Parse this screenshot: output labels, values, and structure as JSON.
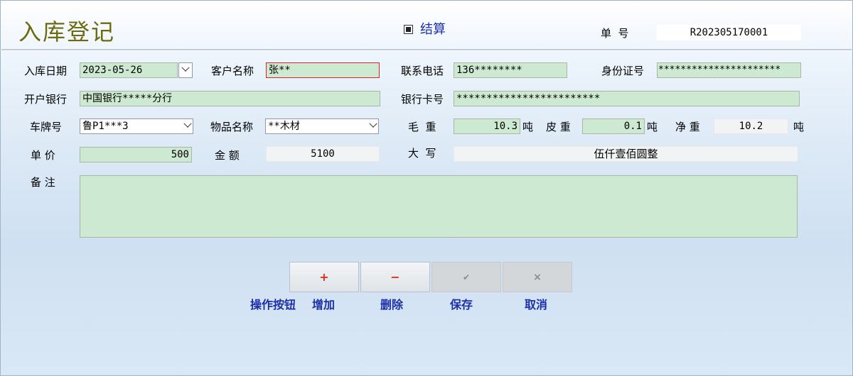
{
  "header": {
    "title": "入库登记",
    "settle_label": "结算",
    "settle_checked": true,
    "doc_no_label": "单  号",
    "doc_no": "R202305170001"
  },
  "form": {
    "date_label": "入库日期",
    "date": "2023-05-26",
    "customer_label": "客户名称",
    "customer": "张**",
    "phone_label": "联系电话",
    "phone": "136********",
    "id_label": "身份证号",
    "id_no": "**********************",
    "bank_label": "开户银行",
    "bank": "中国银行*****分行",
    "card_label": "银行卡号",
    "card_no": "************************",
    "plate_label": "车牌号",
    "plate": "鲁P1***3",
    "goods_label": "物品名称",
    "goods": "**木材",
    "gross_label": "毛  重",
    "gross": "10.3",
    "tare_label": "皮 重",
    "tare": "0.1",
    "net_label": "净 重",
    "net": "10.2",
    "unit_ton": "吨",
    "price_label": "单 价",
    "price": "500",
    "amount_label": "金 额",
    "amount": "5100",
    "capital_label": "大  写",
    "capital": "伍仟壹佰圆整",
    "remark_label": "备 注",
    "remark": ""
  },
  "buttons": {
    "add_symbol": "+",
    "delete_symbol": "−",
    "save_symbol": "✔",
    "cancel_symbol": "×",
    "group_label": "操作按钮",
    "add_label": "增加",
    "delete_label": "删除",
    "save_label": "保存",
    "cancel_label": "取消"
  },
  "colors": {
    "title": "#6b6b12",
    "field_bg": "#cde9d1",
    "button_label": "#1b2fa8",
    "add_symbol": "#e0301e",
    "delete_symbol": "#e0301e"
  }
}
